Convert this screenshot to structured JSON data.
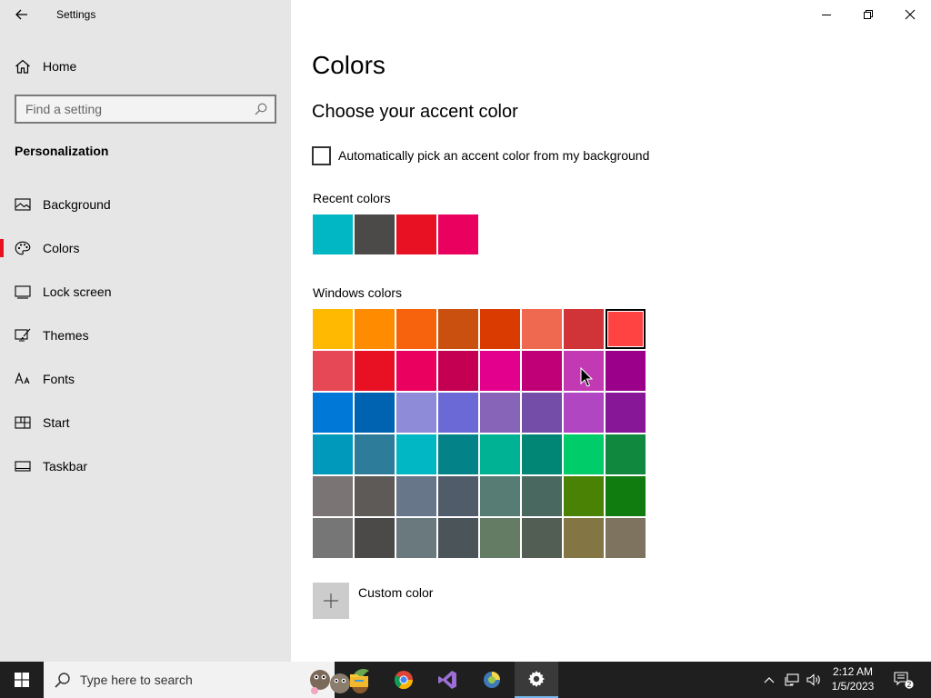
{
  "window": {
    "title": "Settings"
  },
  "sidebar": {
    "home_label": "Home",
    "search_placeholder": "Find a setting",
    "section_title": "Personalization",
    "items": [
      {
        "label": "Background",
        "icon": "image-icon"
      },
      {
        "label": "Colors",
        "icon": "palette-icon",
        "active": true
      },
      {
        "label": "Lock screen",
        "icon": "lock-screen-icon"
      },
      {
        "label": "Themes",
        "icon": "themes-icon"
      },
      {
        "label": "Fonts",
        "icon": "fonts-icon"
      },
      {
        "label": "Start",
        "icon": "start-layout-icon"
      },
      {
        "label": "Taskbar",
        "icon": "taskbar-icon"
      }
    ],
    "active_color": "#e81123"
  },
  "main": {
    "page_title": "Colors",
    "subheading": "Choose your accent color",
    "auto_accent_label": "Automatically pick an accent color from my background",
    "auto_accent_checked": false,
    "recent_label": "Recent colors",
    "recent_colors": [
      "#00b7c3",
      "#4c4a48",
      "#e81123",
      "#ea005e"
    ],
    "windows_label": "Windows colors",
    "windows_colors": [
      [
        "#ffb900",
        "#ff8c00",
        "#f7630c",
        "#ca5010",
        "#da3b01",
        "#ef6950",
        "#d13438",
        "#ff4343"
      ],
      [
        "#e74856",
        "#e81123",
        "#ea005e",
        "#c30052",
        "#e3008c",
        "#bf0077",
        "#c239b3",
        "#9a0089"
      ],
      [
        "#0078d7",
        "#0063b1",
        "#8e8cd8",
        "#6b69d6",
        "#8764b8",
        "#744da9",
        "#b146c2",
        "#881798"
      ],
      [
        "#0099bc",
        "#2d7d9a",
        "#00b7c3",
        "#038387",
        "#00b294",
        "#018574",
        "#00cc6a",
        "#10893e"
      ],
      [
        "#7a7574",
        "#5d5a58",
        "#68768a",
        "#515c6b",
        "#567c73",
        "#486860",
        "#498205",
        "#107c10"
      ],
      [
        "#767676",
        "#4c4a48",
        "#69797e",
        "#4a5459",
        "#647c64",
        "#525e54",
        "#847545",
        "#7e735f"
      ]
    ],
    "selected_color": "#ff4343",
    "custom_color_label": "Custom color"
  },
  "taskbar": {
    "search_placeholder": "Type here to search",
    "apps": [
      "file-explorer-icon",
      "chrome-icon",
      "visual-studio-icon",
      "python-icon",
      "settings-icon"
    ],
    "active_app": "settings-icon",
    "clock_time": "2:12 AM",
    "clock_date": "1/5/2023",
    "notification_count": "2"
  }
}
